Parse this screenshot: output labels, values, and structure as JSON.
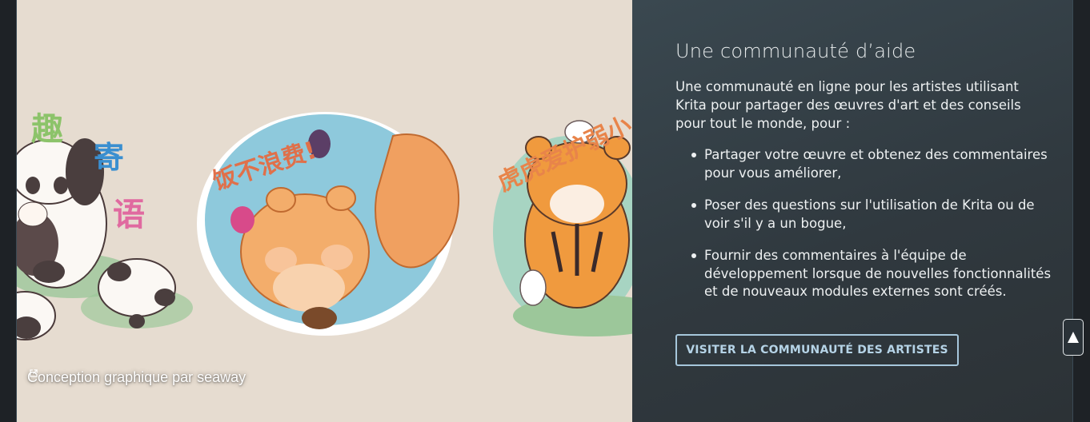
{
  "artwork": {
    "credit_text": "Conception graphique par seaway",
    "external_link_icon": "external-link-icon",
    "panda_calligraphy": [
      "趣",
      "寄",
      "语"
    ],
    "squirrel_calligraphy": "饭不浪费!",
    "tiger_calligraphy": "虎虎爱护弱小"
  },
  "community": {
    "title": "Une communauté d’aide",
    "description": "Une communauté en ligne pour les artistes utilisant Krita pour partager des œuvres d'art et des conseils pour tout le monde, pour :",
    "items": [
      "Partager votre œuvre et obtenez des commentaires pour vous améliorer,",
      "Poser des questions sur l'utilisation de Krita ou de voir s'il y a un bogue,",
      "Fournir des commentaires à l'équipe de développement lorsque de nouvelles fonctionnalités et de nouveaux modules externes sont créés."
    ],
    "button_label": "VISITER LA COMMUNAUTÉ DES ARTISTES"
  },
  "scroll_top": {
    "icon": "arrow-up-icon"
  },
  "colors": {
    "panel_bg": "#323c42",
    "button_border": "#a6c7dc",
    "button_text": "#b5d3e6",
    "art_bg": "#e6dcd0"
  }
}
